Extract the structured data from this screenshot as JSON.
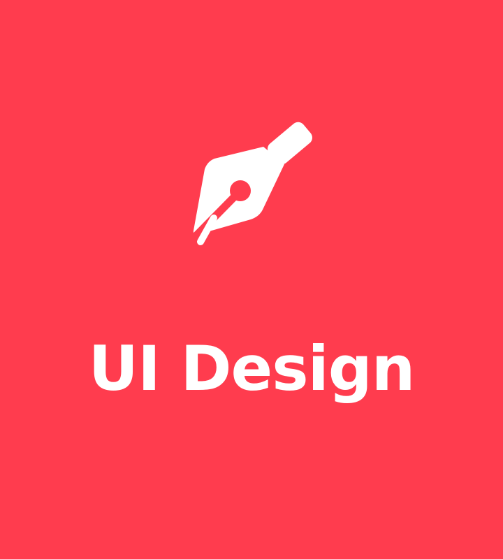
{
  "card": {
    "title": "UI Design",
    "background_color": "#ff3c4e",
    "foreground_color": "#ffffff",
    "icon": "fountain-pen-nib-icon"
  }
}
